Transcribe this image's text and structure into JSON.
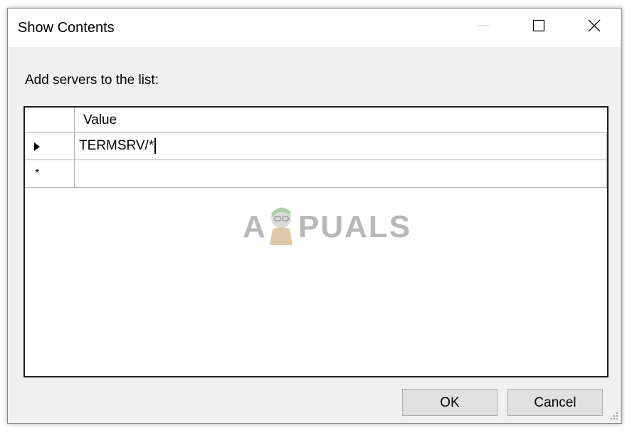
{
  "window": {
    "title": "Show Contents"
  },
  "dialog": {
    "prompt": "Add servers to the list:"
  },
  "grid": {
    "column_header": "Value",
    "rows": [
      {
        "marker": "current-row",
        "value": "TERMSRV/*"
      },
      {
        "marker": "new-row",
        "value": ""
      }
    ],
    "new_row_symbol": "*"
  },
  "buttons": {
    "ok": "OK",
    "cancel": "Cancel"
  },
  "watermark": {
    "text_a": "A",
    "text_rest": "PUALS"
  },
  "colors": {
    "window_bg": "#f0f0f0",
    "titlebar_bg": "#ffffff",
    "button_bg": "#e1e1e1",
    "watermark": "#b8b8b8"
  }
}
